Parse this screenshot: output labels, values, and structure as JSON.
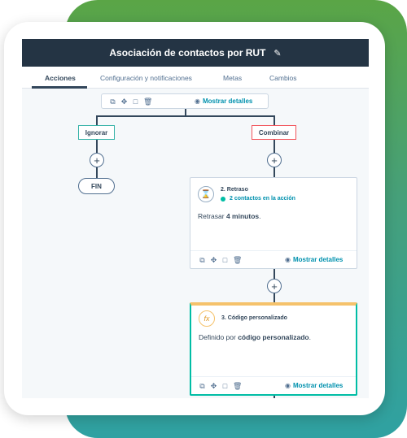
{
  "window": {
    "title": "Asociación de contactos por RUT",
    "title_edit_icon": "pencil-icon"
  },
  "tabs": [
    {
      "label": "Acciones",
      "active": true
    },
    {
      "label": "Configuración y notificaciones",
      "active": false
    },
    {
      "label": "Metas",
      "active": false
    },
    {
      "label": "Cambios",
      "active": false
    }
  ],
  "toolbar": {
    "icons": [
      "copy-icon",
      "move-icon",
      "clone-icon",
      "trash-icon"
    ],
    "details_label": "Mostrar detalles"
  },
  "branches": {
    "ignore": "Ignorar",
    "combine": "Combinar"
  },
  "end_label": "FIN",
  "delay_action": {
    "icon": "hourglass-icon",
    "title": "2. Retraso",
    "status": "2 contactos en la acción",
    "body_prefix": "Retrasar ",
    "body_bold": "4 minutos",
    "body_suffix": "."
  },
  "code_action": {
    "icon": "fx-icon",
    "title": "3. Código personalizado",
    "body_prefix": "Definido por ",
    "body_bold": "código personalizado",
    "body_suffix": "."
  },
  "colors": {
    "header": "#243444",
    "accent_teal": "#00bda5",
    "link": "#0091ae",
    "ignore_border": "#36b3a8",
    "combine_border": "#f2545b",
    "gradient_top": "#5aa546",
    "gradient_bottom": "#2fa1a2"
  }
}
